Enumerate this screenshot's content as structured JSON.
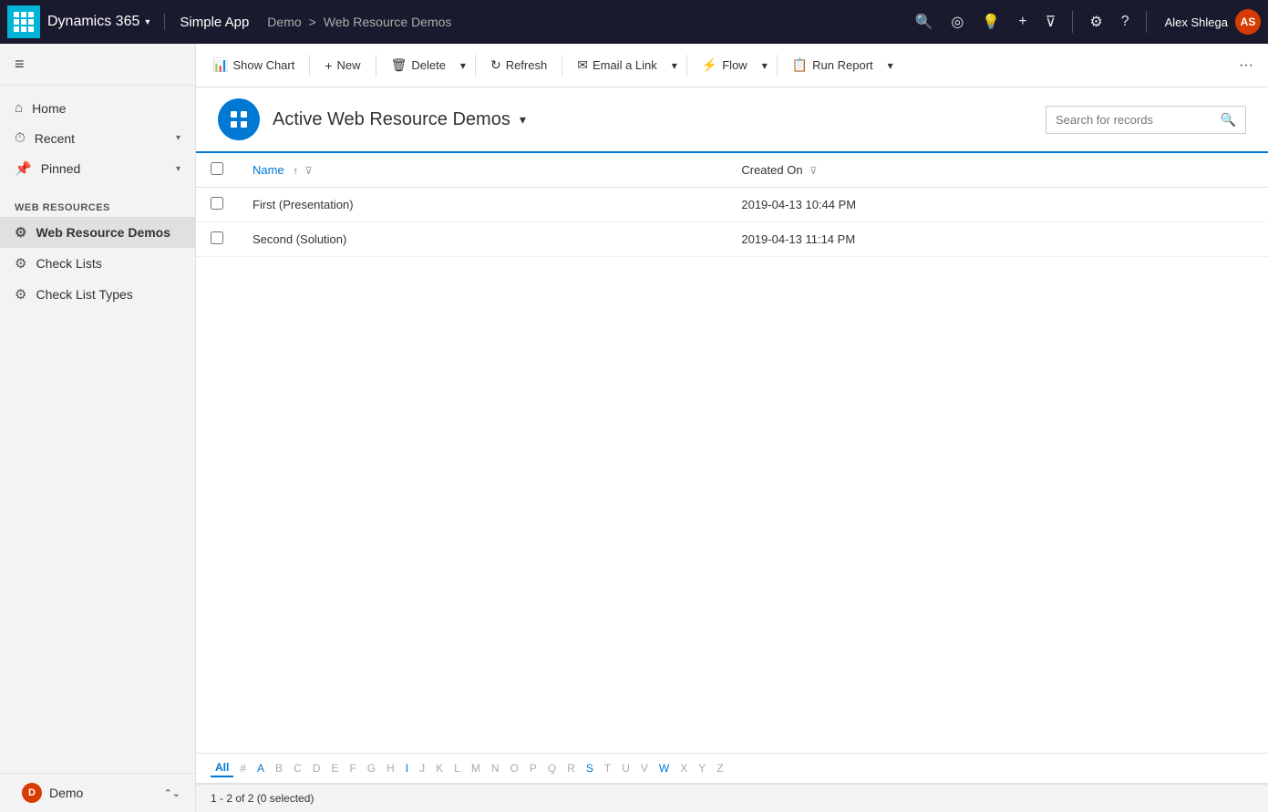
{
  "topNav": {
    "appName": "Dynamics 365",
    "chevron": "▾",
    "simpleApp": "Simple App",
    "breadcrumb": {
      "demo": "Demo",
      "separator": ">",
      "current": "Web Resource Demos"
    },
    "icons": {
      "search": "🔍",
      "target": "◎",
      "bulb": "💡",
      "plus": "+",
      "filter": "⊽",
      "settings": "⚙",
      "help": "?"
    },
    "user": {
      "name": "Alex Shlega",
      "initials": "AS"
    }
  },
  "sidebar": {
    "menuIcon": "≡",
    "navItems": [
      {
        "label": "Home",
        "icon": "⌂"
      },
      {
        "label": "Recent",
        "icon": "⏱",
        "hasChevron": true
      },
      {
        "label": "Pinned",
        "icon": "📌",
        "hasChevron": true
      }
    ],
    "sectionHeader": "Web Resources",
    "sectionItems": [
      {
        "label": "Web Resource Demos",
        "icon": "⚙",
        "active": true
      },
      {
        "label": "Check Lists",
        "icon": "⚙"
      },
      {
        "label": "Check List Types",
        "icon": "⚙"
      }
    ],
    "bottomApp": {
      "label": "Demo",
      "initial": "D"
    }
  },
  "toolbar": {
    "showChartLabel": "Show Chart",
    "newLabel": "New",
    "deleteLabel": "Delete",
    "refreshLabel": "Refresh",
    "emailLinkLabel": "Email a Link",
    "flowLabel": "Flow",
    "runReportLabel": "Run Report",
    "moreIcon": "···"
  },
  "viewHeader": {
    "title": "Active Web Resource Demos",
    "searchPlaceholder": "Search for records"
  },
  "table": {
    "columns": [
      {
        "key": "name",
        "label": "Name",
        "sortable": true,
        "filterable": true,
        "active": true
      },
      {
        "key": "createdOn",
        "label": "Created On",
        "filterable": true
      }
    ],
    "rows": [
      {
        "name": "First (Presentation)",
        "createdOn": "2019-04-13 10:44 PM"
      },
      {
        "name": "Second (Solution)",
        "createdOn": "2019-04-13 11:14 PM"
      }
    ]
  },
  "alphaNav": {
    "items": [
      "All",
      "#",
      "A",
      "B",
      "C",
      "D",
      "E",
      "F",
      "G",
      "H",
      "I",
      "J",
      "K",
      "L",
      "M",
      "N",
      "O",
      "P",
      "Q",
      "R",
      "S",
      "T",
      "U",
      "V",
      "W",
      "X",
      "Y",
      "Z"
    ],
    "active": "All",
    "inactive": [
      "#",
      "B",
      "C",
      "D",
      "E",
      "F",
      "G",
      "H",
      "J",
      "K",
      "L",
      "M",
      "N",
      "O",
      "P",
      "Q",
      "R",
      "T",
      "U",
      "V",
      "X",
      "Y",
      "Z"
    ]
  },
  "statusBar": {
    "text": "1 - 2 of 2 (0 selected)"
  }
}
